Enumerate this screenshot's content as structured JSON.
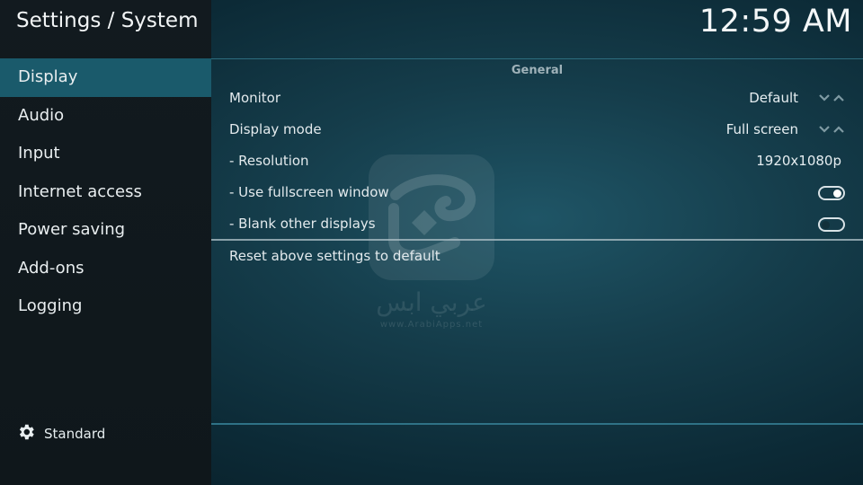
{
  "header": {
    "title": "Settings / System",
    "clock": "12:59 AM"
  },
  "sidebar": {
    "items": [
      {
        "label": "Display",
        "active": true
      },
      {
        "label": "Audio"
      },
      {
        "label": "Input"
      },
      {
        "label": "Internet access"
      },
      {
        "label": "Power saving"
      },
      {
        "label": "Add-ons"
      },
      {
        "label": "Logging"
      }
    ],
    "level": {
      "label": "Standard",
      "icon": "gear-icon"
    }
  },
  "main": {
    "section": "General",
    "rows": [
      {
        "label": "Monitor",
        "value": "Default",
        "control": "spinner"
      },
      {
        "label": "Display mode",
        "value": "Full screen",
        "control": "spinner"
      },
      {
        "label": "- Resolution",
        "value": "1920x1080p"
      },
      {
        "label": "- Use fullscreen window",
        "control": "toggle",
        "on": true
      },
      {
        "label": "- Blank other displays",
        "control": "toggle",
        "on": false
      }
    ],
    "reset": "Reset above settings to default"
  },
  "watermark": {
    "arabic": "عربي ابس",
    "url": "www.ArabiApps.net"
  },
  "colors": {
    "accent": "#1a5a6b",
    "sidebar_bg": "#121a1f",
    "background": "#153d4b"
  }
}
